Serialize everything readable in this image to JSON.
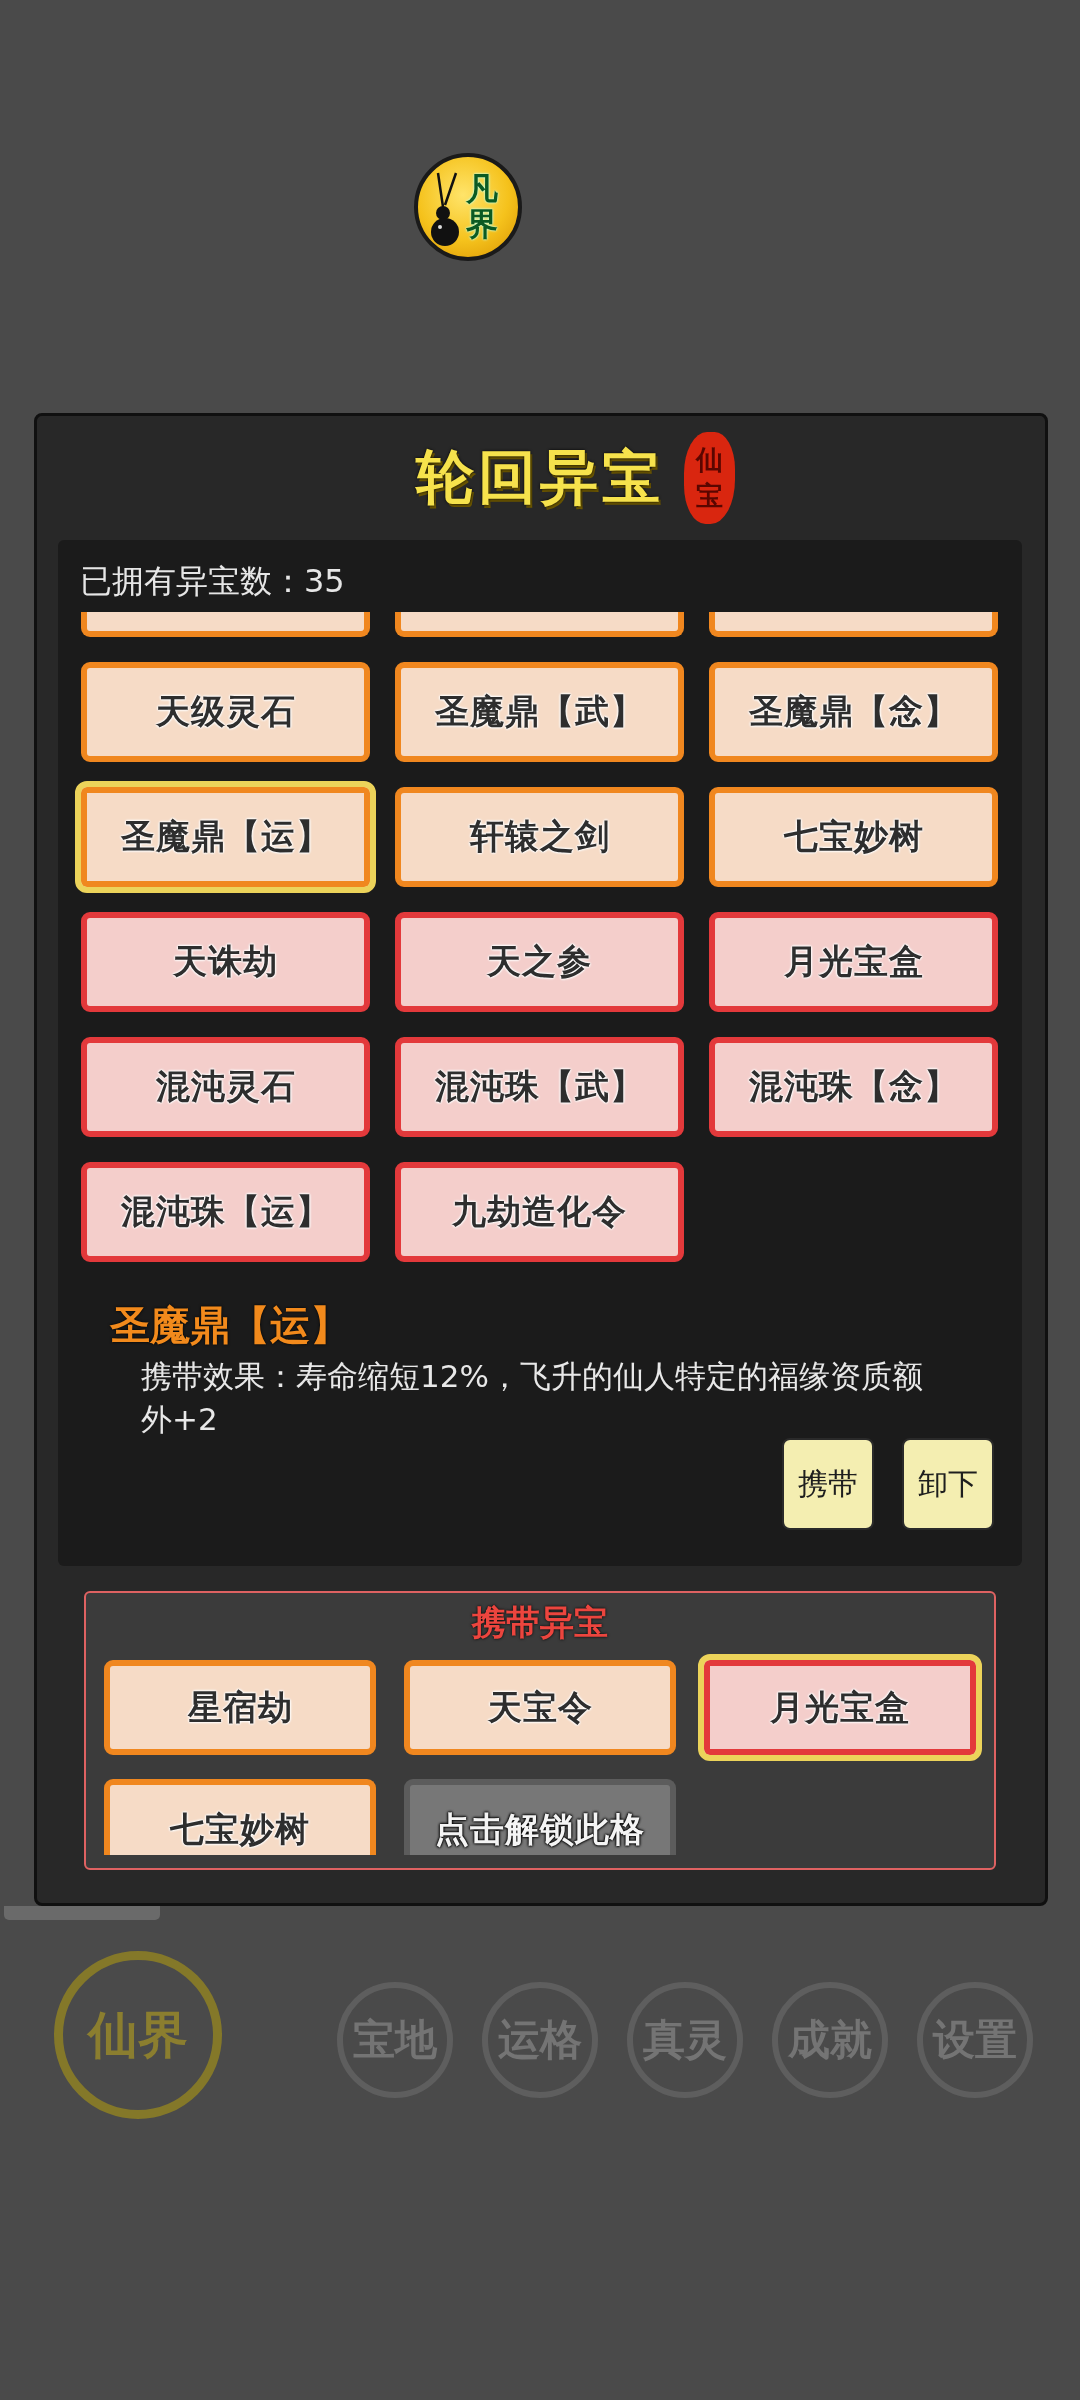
{
  "realm_badge": {
    "label": "凡界"
  },
  "dialog": {
    "title": "轮回异宝",
    "seal": "仙宝"
  },
  "owned_count": "已拥有异宝数：35",
  "grid": {
    "items": [
      {
        "color": "#f0871f",
        "selected": false
      },
      {
        "color": "#f0871f",
        "selected": false
      },
      {
        "color": "#f0871f",
        "selected": false
      },
      {
        "label": "天级灵石",
        "color": "#f0871f",
        "selected": false
      },
      {
        "label": "圣魔鼎【武】",
        "color": "#f0871f",
        "selected": false
      },
      {
        "label": "圣魔鼎【念】",
        "color": "#f0871f",
        "selected": false
      },
      {
        "label": "圣魔鼎【运】",
        "color": "#f0871f",
        "selected": true
      },
      {
        "label": "轩辕之剑",
        "color": "#f0871f",
        "selected": false
      },
      {
        "label": "七宝妙树",
        "color": "#f0871f",
        "selected": false
      },
      {
        "label": "天诛劫",
        "color": "#e3393b",
        "selected": false
      },
      {
        "label": "天之参",
        "color": "#e3393b",
        "selected": false
      },
      {
        "label": "月光宝盒",
        "color": "#e3393b",
        "selected": false
      },
      {
        "label": "混沌灵石",
        "color": "#e3393b",
        "selected": false
      },
      {
        "label": "混沌珠【武】",
        "color": "#e3393b",
        "selected": false
      },
      {
        "label": "混沌珠【念】",
        "color": "#e3393b",
        "selected": false
      },
      {
        "label": "混沌珠【运】",
        "color": "#e3393b",
        "selected": false
      },
      {
        "label": "九劫造化令",
        "color": "#e3393b",
        "selected": false
      }
    ]
  },
  "detail": {
    "name": "圣魔鼎【运】",
    "description": "携带效果：寿命缩短12%，飞升的仙人特定的福缘资质额外+2",
    "buttons": [
      {
        "label": "携带"
      },
      {
        "label": "卸下"
      }
    ]
  },
  "carried": {
    "title": "携带异宝",
    "slots": [
      {
        "kind": "treasure",
        "label": "星宿劫",
        "color": "#f0871f",
        "selected": false
      },
      {
        "kind": "treasure",
        "label": "天宝令",
        "color": "#f0871f",
        "selected": false
      },
      {
        "kind": "treasure",
        "label": "月光宝盒",
        "color": "#e3393b",
        "selected": true
      },
      {
        "kind": "treasure",
        "label": "七宝妙树",
        "color": "#f0871f",
        "selected": false
      },
      {
        "kind": "locked",
        "label": "点击解锁此格",
        "selected": false
      }
    ]
  },
  "realm_button": {
    "label": "仙界"
  },
  "nav": [
    {
      "label": "宝地"
    },
    {
      "label": "运格"
    },
    {
      "label": "真灵"
    },
    {
      "label": "成就"
    },
    {
      "label": "设置"
    }
  ]
}
